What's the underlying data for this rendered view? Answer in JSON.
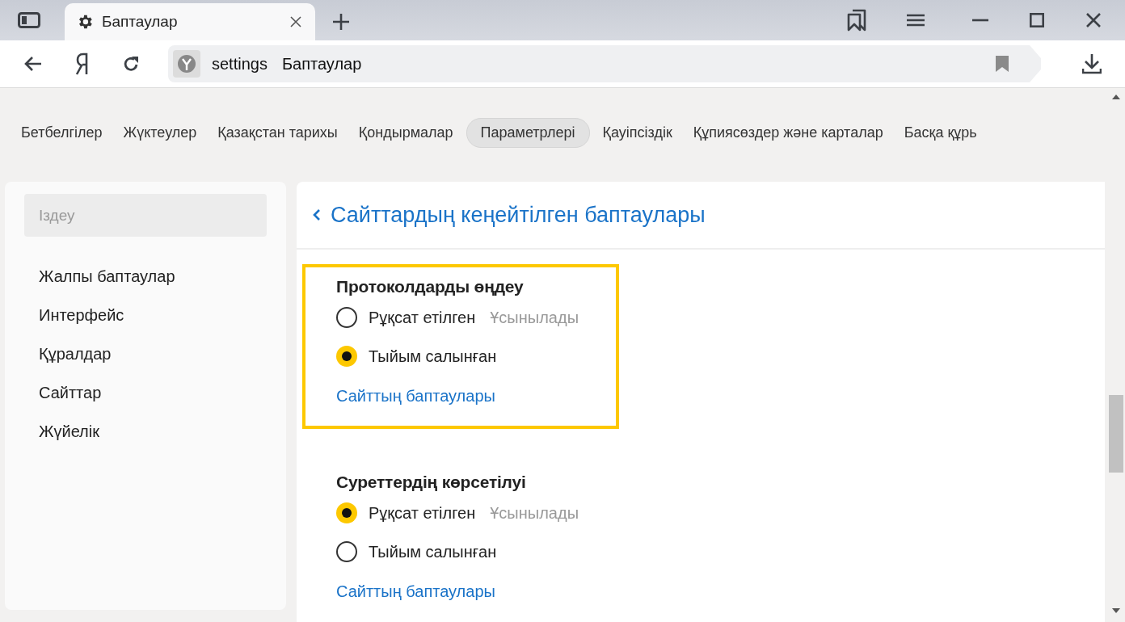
{
  "browser": {
    "tab": {
      "title": "Баптаулар"
    },
    "address": {
      "scheme": "settings",
      "title": "Баптаулар"
    }
  },
  "nav_tabs": [
    {
      "label": "Бетбелгілер",
      "selected": false
    },
    {
      "label": "Жүктеулер",
      "selected": false
    },
    {
      "label": "Қазақстан тарихы",
      "selected": false
    },
    {
      "label": "Қондырмалар",
      "selected": false
    },
    {
      "label": "Параметрлері",
      "selected": true
    },
    {
      "label": "Қауіпсіздік",
      "selected": false
    },
    {
      "label": "Құпиясөздер және карталар",
      "selected": false
    },
    {
      "label": "Басқа құрь",
      "selected": false
    }
  ],
  "sidebar": {
    "search": {
      "placeholder": "Іздеу"
    },
    "items": [
      {
        "label": "Жалпы баптаулар"
      },
      {
        "label": "Интерфейс"
      },
      {
        "label": "Құралдар"
      },
      {
        "label": "Сайттар"
      },
      {
        "label": "Жүйелік"
      }
    ]
  },
  "content": {
    "title": "Сайттардың кеңейтілген баптаулары",
    "sections": [
      {
        "title": "Протоколдарды өңдеу",
        "highlighted": true,
        "options": [
          {
            "label": "Рұқсат етілген",
            "hint": "Ұсынылады",
            "selected": false
          },
          {
            "label": "Тыйым салынған",
            "selected": true
          }
        ],
        "link": "Сайттың баптаулары"
      },
      {
        "title": "Суреттердің көрсетілуі",
        "highlighted": false,
        "options": [
          {
            "label": "Рұқсат етілген",
            "hint": "Ұсынылады",
            "selected": true
          },
          {
            "label": "Тыйым салынған",
            "selected": false
          }
        ],
        "link": "Сайттың баптаулары"
      }
    ]
  }
}
